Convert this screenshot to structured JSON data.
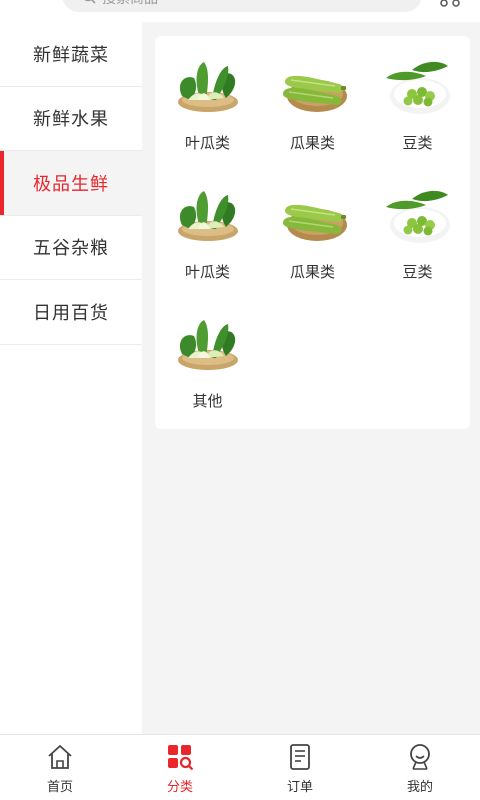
{
  "search": {
    "placeholder": "搜索商品",
    "icon": "search-icon"
  },
  "header": {
    "more_icon": "more-icon"
  },
  "sidebar": {
    "items": [
      {
        "label": "新鲜蔬菜",
        "active": false
      },
      {
        "label": "新鲜水果",
        "active": false
      },
      {
        "label": "极品生鲜",
        "active": true
      },
      {
        "label": "五谷杂粮",
        "active": false
      },
      {
        "label": "日用百货",
        "active": false
      }
    ]
  },
  "categories": [
    {
      "label": "叶瓜类",
      "image": "bok-choy-image"
    },
    {
      "label": "瓜果类",
      "image": "zucchini-image"
    },
    {
      "label": "豆类",
      "image": "edamame-image"
    },
    {
      "label": "叶瓜类",
      "image": "bok-choy-image"
    },
    {
      "label": "瓜果类",
      "image": "zucchini-image"
    },
    {
      "label": "豆类",
      "image": "edamame-image"
    },
    {
      "label": "其他",
      "image": "bok-choy-image"
    }
  ],
  "tabbar": {
    "tabs": [
      {
        "label": "首页",
        "icon": "home-icon",
        "active": false
      },
      {
        "label": "分类",
        "icon": "category-icon",
        "active": true
      },
      {
        "label": "订单",
        "icon": "order-icon",
        "active": false
      },
      {
        "label": "我的",
        "icon": "profile-icon",
        "active": false
      }
    ]
  },
  "colors": {
    "accent": "#e8262c",
    "background": "#f4f4f4",
    "panel": "#ffffff",
    "text": "#333333"
  }
}
